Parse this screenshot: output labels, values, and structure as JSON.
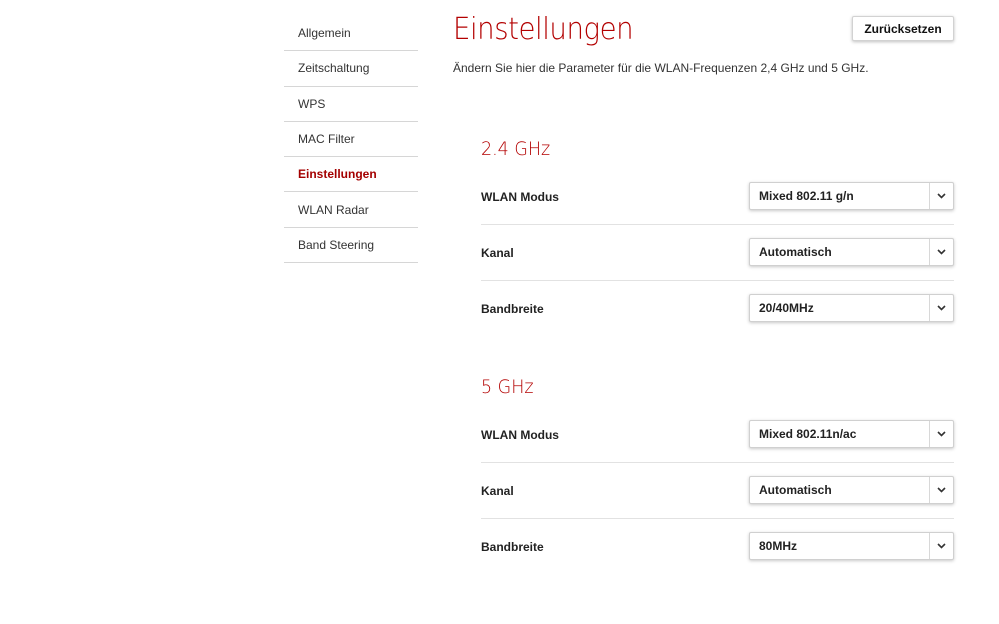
{
  "sidebar": {
    "items": [
      {
        "label": "Allgemein",
        "active": false
      },
      {
        "label": "Zeitschaltung",
        "active": false
      },
      {
        "label": "WPS",
        "active": false
      },
      {
        "label": "MAC Filter",
        "active": false
      },
      {
        "label": "Einstellungen",
        "active": true
      },
      {
        "label": "WLAN Radar",
        "active": false
      },
      {
        "label": "Band Steering",
        "active": false
      }
    ]
  },
  "header": {
    "title": "Einstellungen",
    "reset_label": "Zurücksetzen",
    "description": "Ändern Sie hier die Parameter für die WLAN-Frequenzen 2,4 GHz und 5 GHz."
  },
  "band24": {
    "title": "2.4 GHz",
    "rows": [
      {
        "label": "WLAN Modus",
        "value": "Mixed 802.11 g/n"
      },
      {
        "label": "Kanal",
        "value": "Automatisch"
      },
      {
        "label": "Bandbreite",
        "value": "20/40MHz"
      }
    ]
  },
  "band5": {
    "title": "5 GHz",
    "rows": [
      {
        "label": "WLAN Modus",
        "value": "Mixed 802.11n/ac"
      },
      {
        "label": "Kanal",
        "value": "Automatisch"
      },
      {
        "label": "Bandbreite",
        "value": "80MHz"
      }
    ]
  },
  "colors": {
    "accent": "#b30000",
    "active_nav": "#a40000",
    "divider": "#d6d6d6"
  },
  "icons": {
    "dropdown": "chevron-down-icon"
  }
}
